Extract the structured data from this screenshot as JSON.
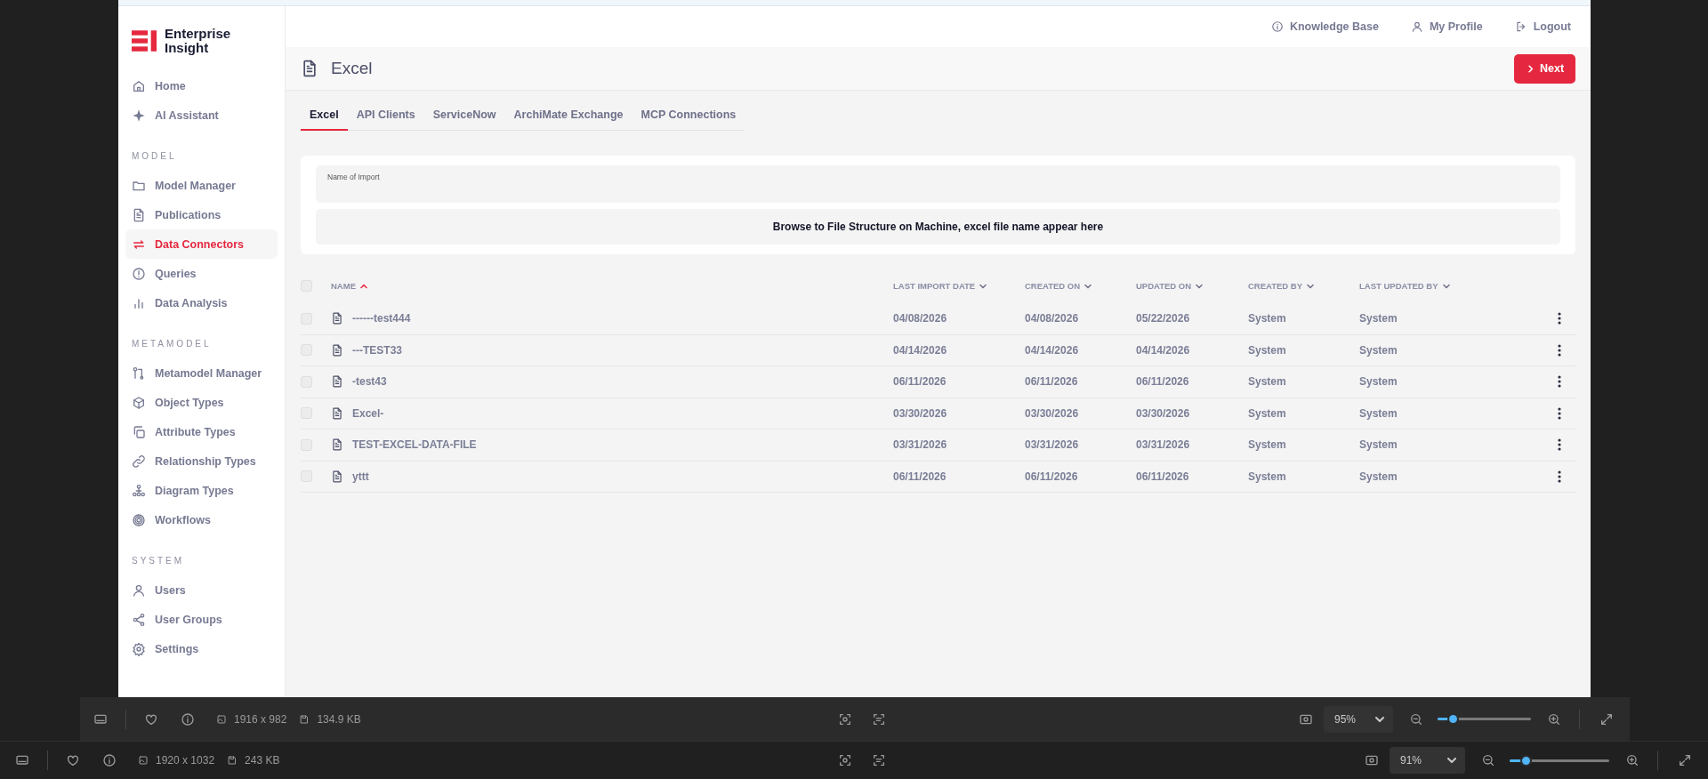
{
  "app": {
    "brand": "Enterprise Insight",
    "sidebar": {
      "sections": [
        {
          "items": [
            {
              "label": "Home",
              "selected": false
            },
            {
              "label": "AI Assistant",
              "selected": false
            }
          ]
        },
        {
          "heading": "MODEL",
          "items": [
            {
              "label": "Model Manager",
              "selected": false
            },
            {
              "label": "Publications",
              "selected": false
            },
            {
              "label": "Data Connectors",
              "selected": true
            },
            {
              "label": "Queries",
              "selected": false
            },
            {
              "label": "Data Analysis",
              "selected": false
            }
          ]
        },
        {
          "heading": "METAMODEL",
          "items": [
            {
              "label": "Metamodel Manager",
              "selected": false
            },
            {
              "label": "Object Types",
              "selected": false
            },
            {
              "label": "Attribute Types",
              "selected": false
            },
            {
              "label": "Relationship Types",
              "selected": false
            },
            {
              "label": "Diagram Types",
              "selected": false
            },
            {
              "label": "Workflows",
              "selected": false
            }
          ]
        },
        {
          "heading": "SYSTEM",
          "items": [
            {
              "label": "Users",
              "selected": false
            },
            {
              "label": "User Groups",
              "selected": false
            },
            {
              "label": "Settings",
              "selected": false
            }
          ]
        }
      ]
    },
    "header_links": [
      "Knowledge Base",
      "My Profile",
      "Logout"
    ],
    "page_title": "Excel",
    "next_button": "Next",
    "tabs": [
      {
        "label": "Excel",
        "selected": true
      },
      {
        "label": "API Clients",
        "selected": false
      },
      {
        "label": "ServiceNow",
        "selected": false
      },
      {
        "label": "ArchiMate Exchange",
        "selected": false
      },
      {
        "label": "MCP Connections",
        "selected": false
      }
    ],
    "import_form": {
      "name_field": {
        "label": "Name of Import"
      },
      "file_drop": "Browse to File Structure on Machine, excel file name appear here"
    },
    "table": {
      "select_all": {
        "checked": false
      },
      "columns": [
        {
          "label": "NAME",
          "sorted": true
        },
        {
          "label": "LAST IMPORT DATE",
          "sorted": false
        },
        {
          "label": "CREATED ON",
          "sorted": false
        },
        {
          "label": "UPDATED ON",
          "sorted": false
        },
        {
          "label": "CREATED BY",
          "sorted": false
        },
        {
          "label": "LAST UPDATED BY",
          "sorted": false
        }
      ],
      "rows": [
        {
          "checked": false,
          "cells": [
            "------test444",
            "04/08/2026",
            "04/08/2026",
            "05/22/2026",
            "System",
            "System"
          ]
        },
        {
          "checked": false,
          "cells": [
            "---TEST33",
            "04/14/2026",
            "04/14/2026",
            "04/14/2026",
            "System",
            "System"
          ]
        },
        {
          "checked": false,
          "cells": [
            "-test43",
            "06/11/2026",
            "06/11/2026",
            "06/11/2026",
            "System",
            "System"
          ]
        },
        {
          "checked": false,
          "cells": [
            "Excel-",
            "03/30/2026",
            "03/30/2026",
            "03/30/2026",
            "System",
            "System"
          ]
        },
        {
          "checked": false,
          "cells": [
            "TEST-EXCEL-DATA-FILE",
            "03/31/2026",
            "03/31/2026",
            "03/31/2026",
            "System",
            "System"
          ]
        },
        {
          "checked": false,
          "cells": [
            "yttt",
            "06/11/2026",
            "06/11/2026",
            "06/11/2026",
            "System",
            "System"
          ]
        }
      ]
    }
  },
  "viewer_toolbars": [
    {
      "dimensions": "1916 x 982",
      "file_size": "134.9 KB",
      "zoom": "95%",
      "zoom_slider": {
        "level": 0.16
      }
    },
    {
      "dimensions": "1920 x 1032",
      "file_size": "243 KB",
      "zoom": "91%",
      "zoom_slider": {
        "level": 0.16
      }
    }
  ]
}
